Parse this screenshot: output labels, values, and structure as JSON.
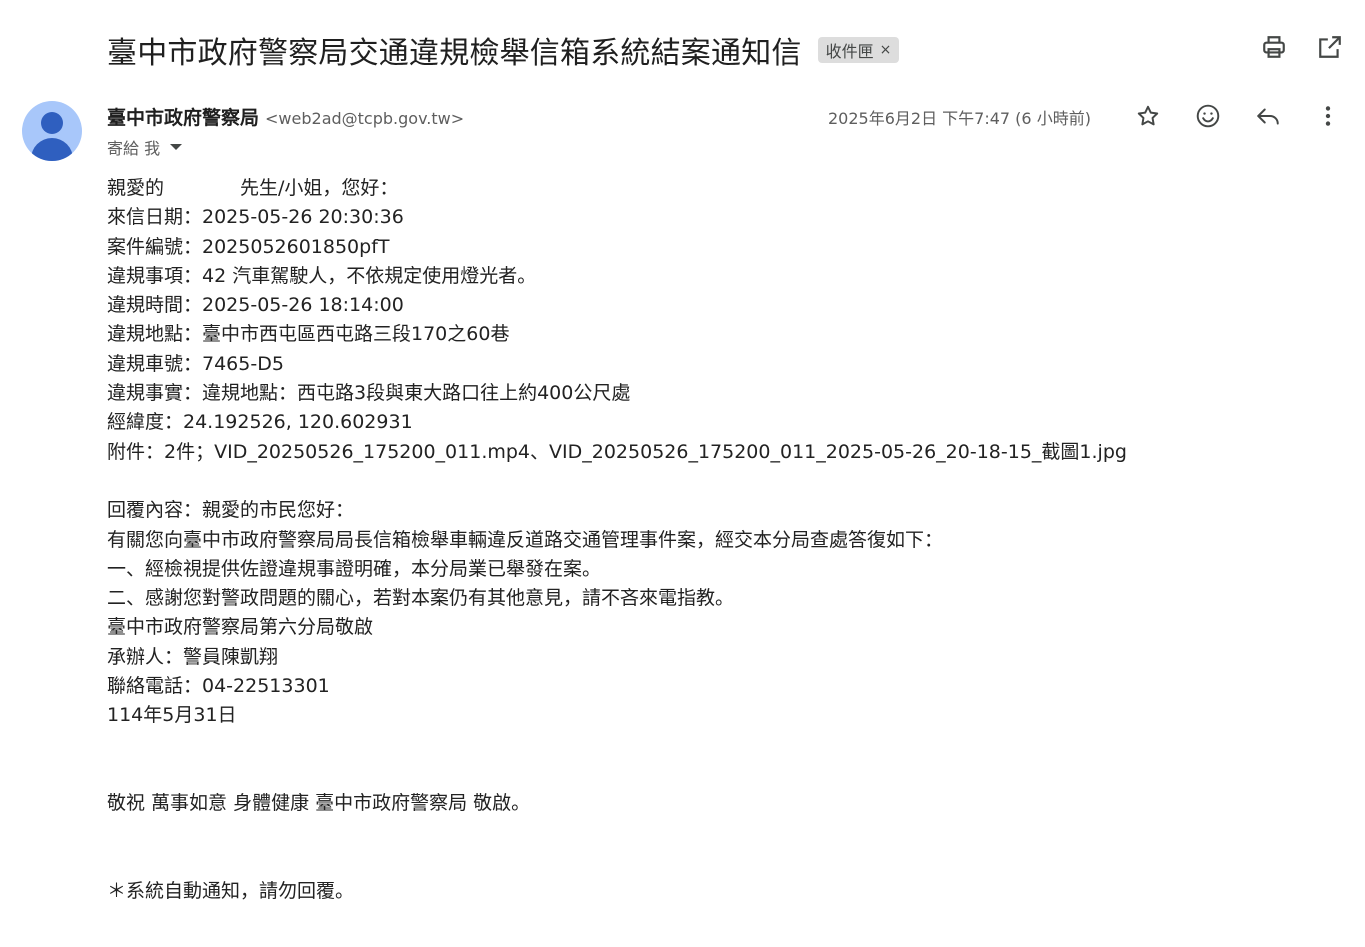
{
  "subject": "臺中市政府警察局交通違規檢舉信箱系統結案通知信",
  "label": {
    "text": "收件匣",
    "close": "×"
  },
  "top_actions": {
    "print_icon": "print-icon",
    "open_new_window_icon": "open-in-new-icon"
  },
  "sender": {
    "name": "臺中市政府警察局",
    "email": "<web2ad@tcpb.gov.tw>",
    "to": "寄給 我",
    "date": "2025年6月2日 下午7:47 (6 小時前)"
  },
  "message_actions": [
    "star-icon",
    "emoji-icon",
    "reply-icon",
    "more-vert-icon"
  ],
  "body": {
    "greeting": "親愛的　　　　先生/小姐，您好：",
    "received_date": "來信日期：2025-05-26 20:30:36",
    "case_number": "案件編號：2025052601850pfT",
    "violation_item": "違規事項：42 汽車駕駛人，不依規定使用燈光者。",
    "violation_time": "違規時間：2025-05-26 18:14:00",
    "violation_location": "違規地點：臺中市西屯區西屯路三段170之60巷",
    "plate_number": "違規車號：7465-D5",
    "violation_fact": "違規事實：違規地點：西屯路3段與東大路口往上約400公尺處",
    "coordinates": "經緯度：24.192526, 120.602931",
    "attachments": "附件：2件；VID_20250526_175200_011.mp4、VID_20250526_175200_011_2025-05-26_20-18-15_截圖1.jpg",
    "reply_header": "回覆內容：親愛的市民您好：",
    "reply_intro": "有關您向臺中市政府警察局局長信箱檢舉車輛違反道路交通管理事件案，經交本分局查處答復如下：",
    "reply_point1": "一、經檢視提供佐證違規事證明確，本分局業已舉發在案。",
    "reply_point2": "二、感謝您對警政問題的關心，若對本案仍有其他意見，請不吝來電指教。",
    "signature_unit": "臺中市政府警察局第六分局敬啟",
    "handler": "承辦人：警員陳凱翔",
    "phone": "聯絡電話：04-22513301",
    "reply_date": "114年5月31日",
    "closing": "敬祝 萬事如意 身體健康 臺中市政府警察局 敬啟。",
    "auto_notice": "＊系統自動通知，請勿回覆。"
  }
}
